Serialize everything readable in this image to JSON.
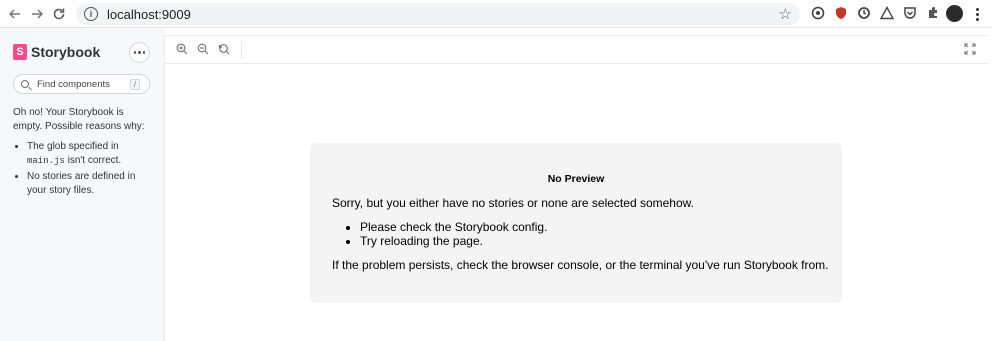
{
  "browser": {
    "url": "localhost:9009"
  },
  "sidebar": {
    "brand": "Storybook",
    "search_placeholder": "Find components",
    "search_shortcut": "/",
    "empty_title": "Oh no! Your Storybook is empty. Possible reasons why:",
    "reason_1_prefix": "The glob specified in",
    "reason_1_code": "main.js",
    "reason_1_suffix": "isn't correct.",
    "reason_2": "No stories are defined in your story files."
  },
  "preview": {
    "title": "No Preview",
    "description": "Sorry, but you either have no stories or none are selected somehow.",
    "items": [
      "Please check the Storybook config.",
      "Try reloading the page."
    ],
    "footer": "If the problem persists, check the browser console, or the terminal you've run Storybook from."
  },
  "icons": {
    "back": "arrow-left-icon",
    "forward": "arrow-right-icon",
    "reload": "reload-icon",
    "info": "info-icon",
    "bookmark": "star-icon",
    "zoom_in": "zoom-in-icon",
    "zoom_out": "zoom-out-icon",
    "zoom_reset": "zoom-reset-icon",
    "fullscreen": "fullscreen-icon"
  },
  "colors": {
    "brand": "#ff4785",
    "sidebar_bg": "#f6f9fc",
    "card_bg": "#f4f4f4"
  }
}
